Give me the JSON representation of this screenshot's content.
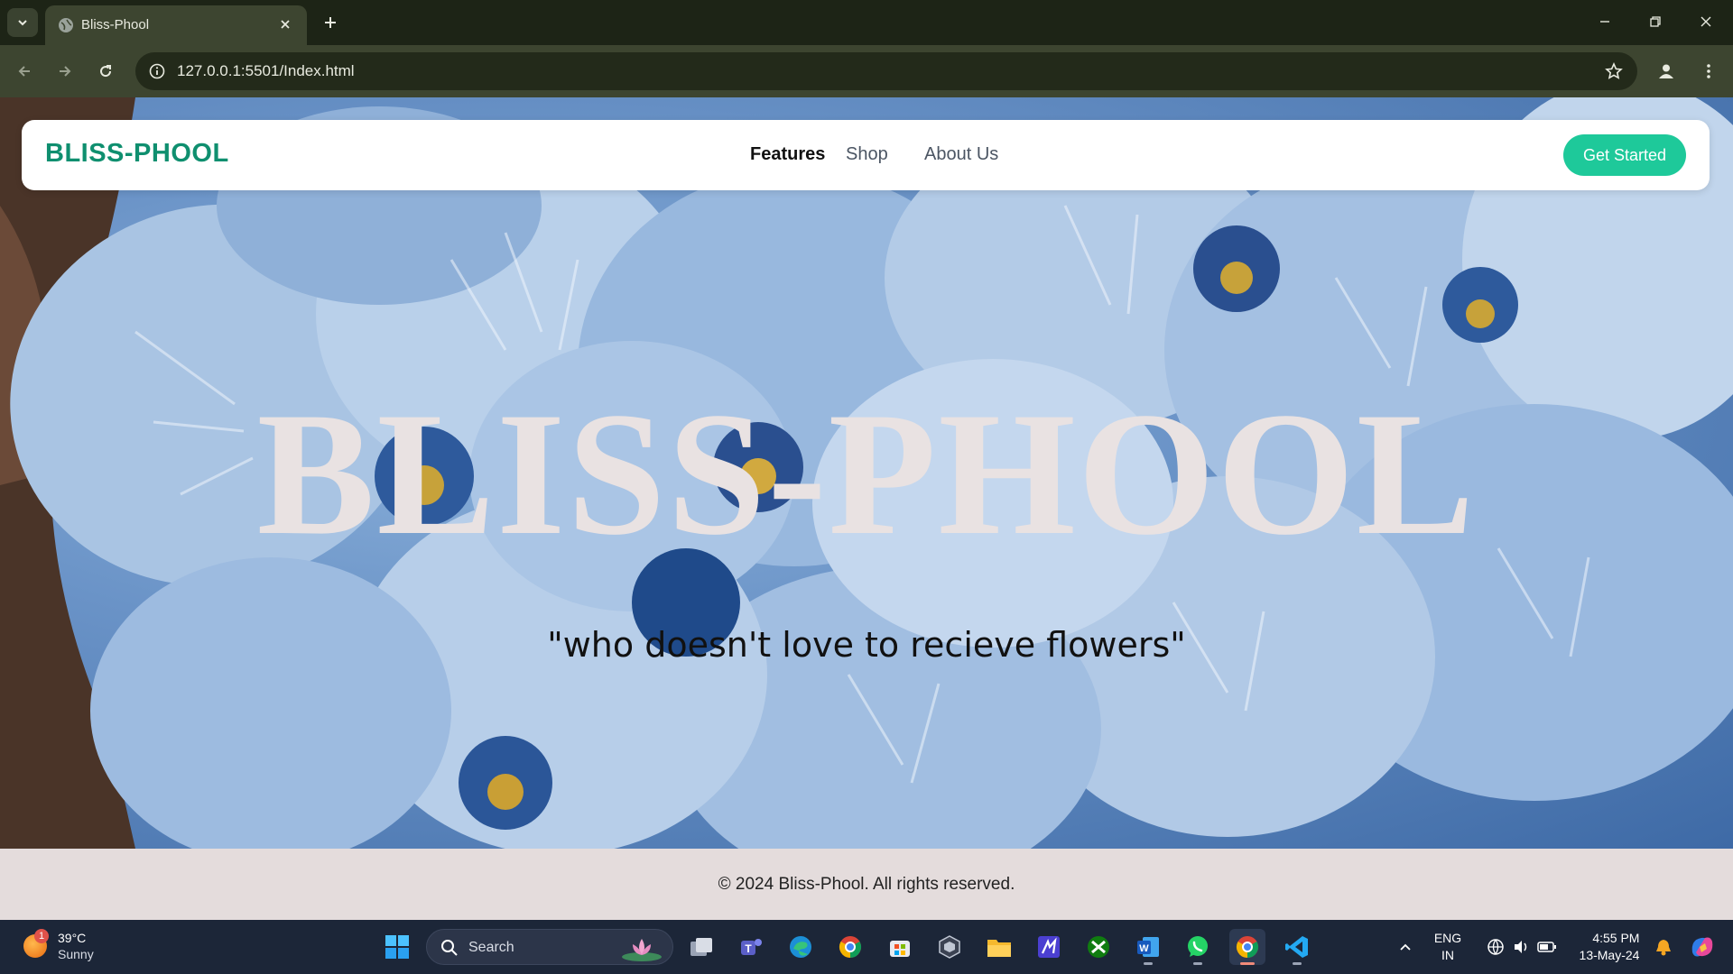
{
  "browser": {
    "tab_title": "Bliss-Phool",
    "url": "127.0.0.1:5501/Index.html"
  },
  "site": {
    "brand": "BLISS-PHOOL",
    "nav": [
      {
        "label": "Features",
        "active": true
      },
      {
        "label": "Shop",
        "active": false
      },
      {
        "label": "About Us",
        "active": false
      }
    ],
    "cta_label": "Get Started",
    "hero_title": "BLISS-PHOOL",
    "hero_quote": "\"who doesn't love to recieve flowers\"",
    "footer_text": "© 2024 Bliss-Phool. All rights reserved.",
    "colors": {
      "brand": "#0f8f6f",
      "cta": "#1ec99a",
      "footer_bg": "#e4dcdc",
      "hero_title": "#e9e2e2"
    }
  },
  "taskbar": {
    "weather": {
      "badge": "1",
      "temp": "39°C",
      "desc": "Sunny"
    },
    "search_label": "Search",
    "apps": [
      "windows-start-icon",
      "task-view-icon",
      "teams-icon",
      "edge-icon",
      "chrome-icon",
      "store-icon",
      "dev-tool-icon",
      "file-explorer-icon",
      "pen-app-icon",
      "xbox-icon",
      "word-icon",
      "whatsapp-icon",
      "chrome-active-icon",
      "vscode-icon"
    ],
    "language": {
      "line1": "ENG",
      "line2": "IN"
    },
    "clock": {
      "time": "4:55 PM",
      "date": "13-May-24"
    }
  }
}
